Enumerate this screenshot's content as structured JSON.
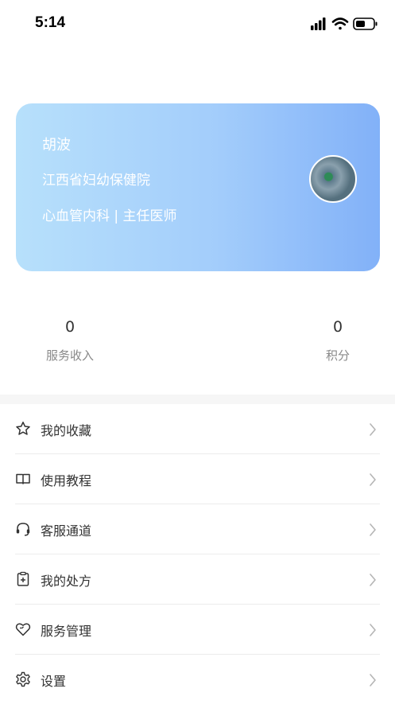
{
  "status_bar": {
    "time": "5:14"
  },
  "profile": {
    "name": "胡波",
    "hospital": "江西省妇幼保健院",
    "department_title": "心血管内科 | 主任医师"
  },
  "stats": {
    "income": {
      "value": "0",
      "label": "服务收入"
    },
    "points": {
      "value": "0",
      "label": "积分"
    }
  },
  "menu": [
    {
      "label": "我的收藏",
      "icon": "star-icon"
    },
    {
      "label": "使用教程",
      "icon": "book-icon"
    },
    {
      "label": "客服通道",
      "icon": "headset-icon"
    },
    {
      "label": "我的处方",
      "icon": "prescription-icon"
    },
    {
      "label": "服务管理",
      "icon": "heart-icon"
    },
    {
      "label": "设置",
      "icon": "gear-icon"
    }
  ],
  "colors": {
    "card_gradient_start": "#b7e0fb",
    "card_gradient_end": "#82b1f8",
    "text_primary": "#333333",
    "text_secondary": "#888888"
  }
}
